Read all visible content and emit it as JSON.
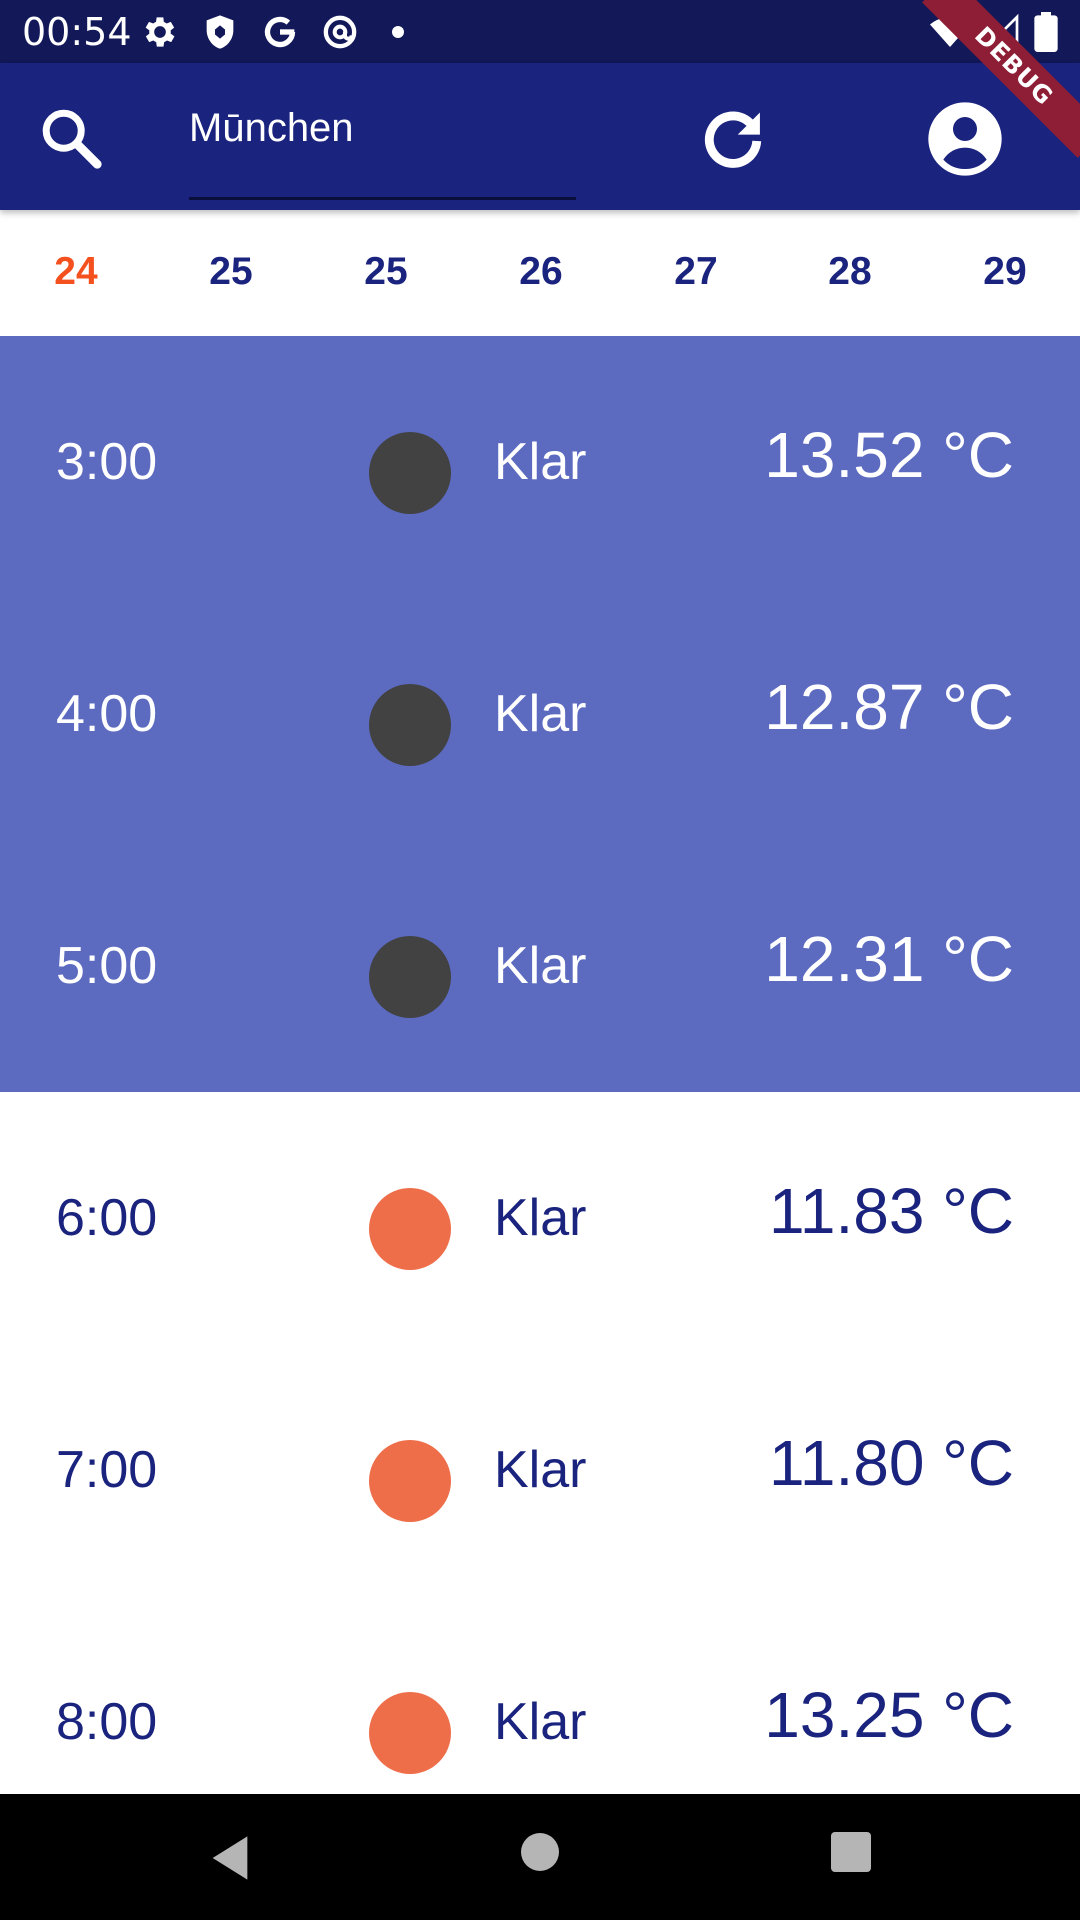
{
  "status_bar": {
    "time": "00:54",
    "left_icons": [
      "gear-icon",
      "shield-icon",
      "google-icon",
      "at-sign-icon",
      "dot-icon"
    ],
    "right_icons": [
      "wifi-icon",
      "signal-icon",
      "battery-icon"
    ]
  },
  "debug_banner": {
    "label": "DEBUG",
    "color": "#8e1e35"
  },
  "app_bar": {
    "search_icon": "search-icon",
    "city_value": "Mūnchen",
    "refresh_icon": "refresh-icon",
    "account_icon": "account-circle-icon",
    "background": "#1a237e"
  },
  "date_tabs": [
    {
      "label": "24",
      "selected": true
    },
    {
      "label": "25",
      "selected": false
    },
    {
      "label": "25",
      "selected": false
    },
    {
      "label": "26",
      "selected": false
    },
    {
      "label": "27",
      "selected": false
    },
    {
      "label": "28",
      "selected": false
    },
    {
      "label": "29",
      "selected": false
    }
  ],
  "hours": [
    {
      "time": "3:00",
      "condition": "Klar",
      "temp": "13.52 °C",
      "period": "night"
    },
    {
      "time": "4:00",
      "condition": "Klar",
      "temp": "12.87 °C",
      "period": "night"
    },
    {
      "time": "5:00",
      "condition": "Klar",
      "temp": "12.31 °C",
      "period": "night"
    },
    {
      "time": "6:00",
      "condition": "Klar",
      "temp": "11.83 °C",
      "period": "day"
    },
    {
      "time": "7:00",
      "condition": "Klar",
      "temp": "11.80 °C",
      "period": "day"
    },
    {
      "time": "8:00",
      "condition": "Klar",
      "temp": "13.25 °C",
      "period": "day"
    }
  ],
  "colors": {
    "night_row": "#5c6bc0",
    "night_icon": "#424242",
    "day_icon": "#ee6e4a",
    "selected_tab": "#f4511e",
    "primary_text": "#1a237e"
  },
  "nav_bar": {
    "icons": [
      "back-icon",
      "home-icon",
      "recents-icon"
    ]
  }
}
